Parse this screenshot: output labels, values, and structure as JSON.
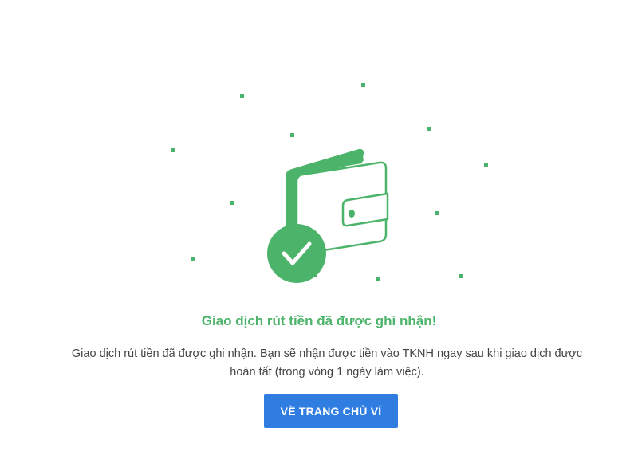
{
  "success": {
    "title": "Giao dịch rút tiền đã được ghi nhận!",
    "message": "Giao dịch rút tiền đã được ghi nhận. Bạn sẽ nhận được tiền vào TKNH ngay sau khi giao dịch được hoàn tất (trong vòng 1 ngày làm việc).",
    "button_label": "VỀ TRANG CHỦ VÍ"
  },
  "icons": {
    "illustration": "wallet-icon",
    "badge": "checkmark-icon"
  },
  "colors": {
    "accent_green": "#4cb46a",
    "button_blue": "#2f7de1",
    "text_gray": "#444444"
  }
}
